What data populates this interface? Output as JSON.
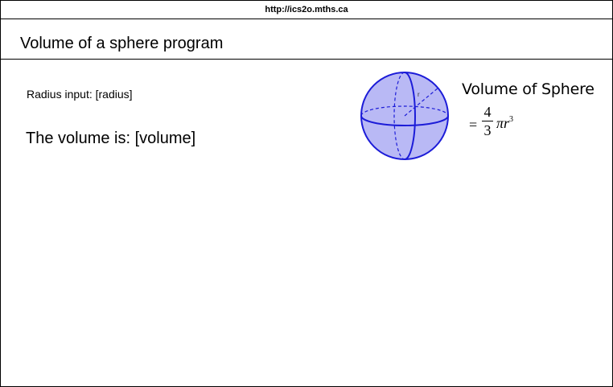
{
  "browser": {
    "url": "http://ics2o.mths.ca"
  },
  "header": {
    "title": "Volume of a sphere program"
  },
  "main": {
    "radius_label": "Radius input: [radius]",
    "volume_label": "The volume is: [volume]"
  },
  "diagram": {
    "title": "Volume of Sphere",
    "formula": {
      "equals": "=",
      "numerator": "4",
      "denominator": "3",
      "expression": "πr",
      "exponent": "3"
    },
    "radius_marker": "r",
    "sphere_fill": "#b9b9f5",
    "sphere_stroke": "#1c1cd8"
  }
}
